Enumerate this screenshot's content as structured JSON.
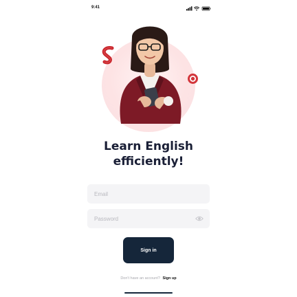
{
  "status_bar": {
    "time": "9:41",
    "icons": [
      "signal-icon",
      "wifi-icon",
      "battery-icon"
    ]
  },
  "hero": {
    "illustration": "woman-with-phone-avatar",
    "decorations": [
      "app-logo-icon",
      "record-icon"
    ]
  },
  "title": {
    "line1": "Learn English",
    "line2": "efficiently!"
  },
  "form": {
    "email_placeholder": "Email",
    "email_value": "",
    "password_placeholder": "Password",
    "password_value": "",
    "password_toggle_icon": "eye-icon",
    "signin_label": "Sign in"
  },
  "footer": {
    "prompt": "Don't have an account?",
    "signup_label": "Sign up"
  },
  "colors": {
    "primary": "#15263a",
    "accent": "#c9262c",
    "title": "#1a1f36",
    "input_bg": "#f4f4f6",
    "placeholder": "#b8b8be"
  }
}
